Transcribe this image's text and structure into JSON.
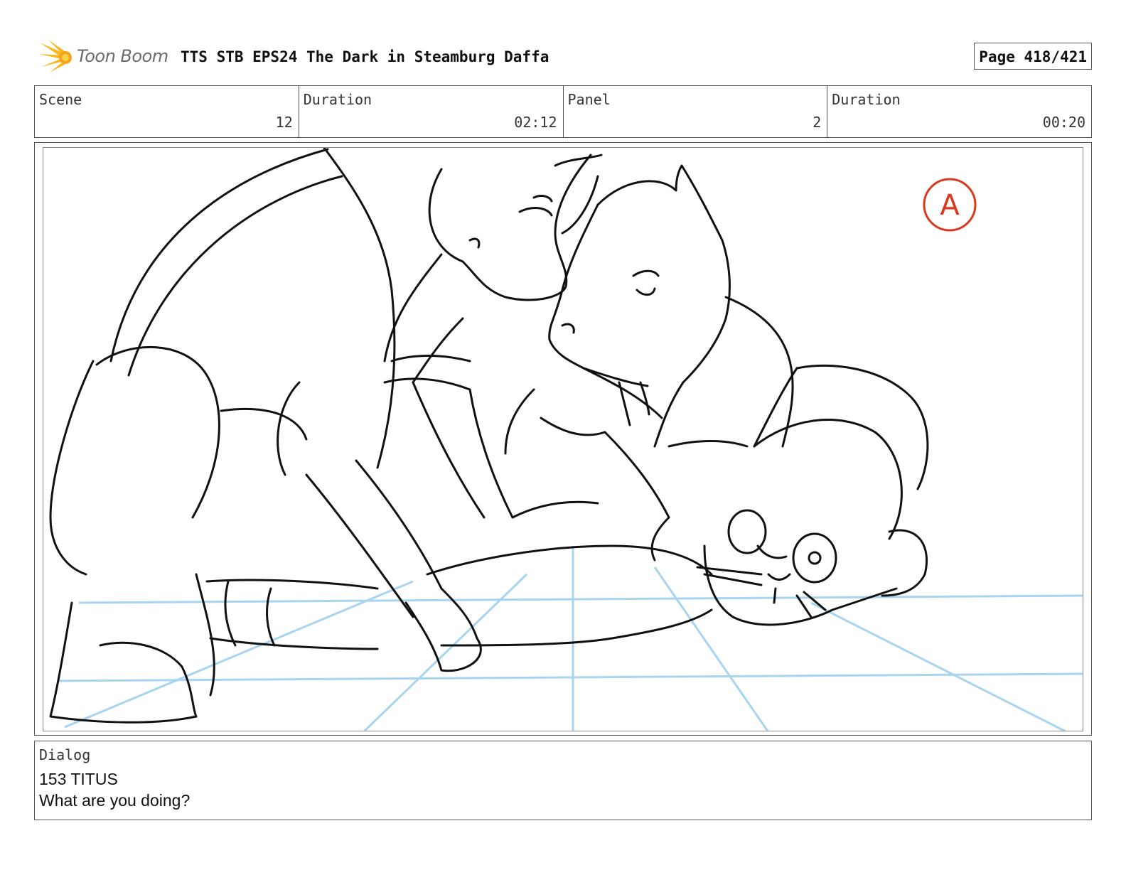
{
  "header": {
    "logo_text": "Toon Boom",
    "title": "TTS STB EPS24 The Dark in Steamburg Daffa",
    "page": "Page 418/421"
  },
  "info": {
    "scene_label": "Scene",
    "scene_value": "12",
    "scene_duration_label": "Duration",
    "scene_duration_value": "02:12",
    "panel_label": "Panel",
    "panel_value": "2",
    "panel_duration_label": "Duration",
    "panel_duration_value": "00:20"
  },
  "panel": {
    "annotation_mark": "A",
    "colors": {
      "line": "#111111",
      "perspective": "#a9d4ef",
      "annotation": "#d9381e"
    }
  },
  "dialog": {
    "label": "Dialog",
    "speaker": "153 TITUS",
    "line": "What are you doing?"
  }
}
